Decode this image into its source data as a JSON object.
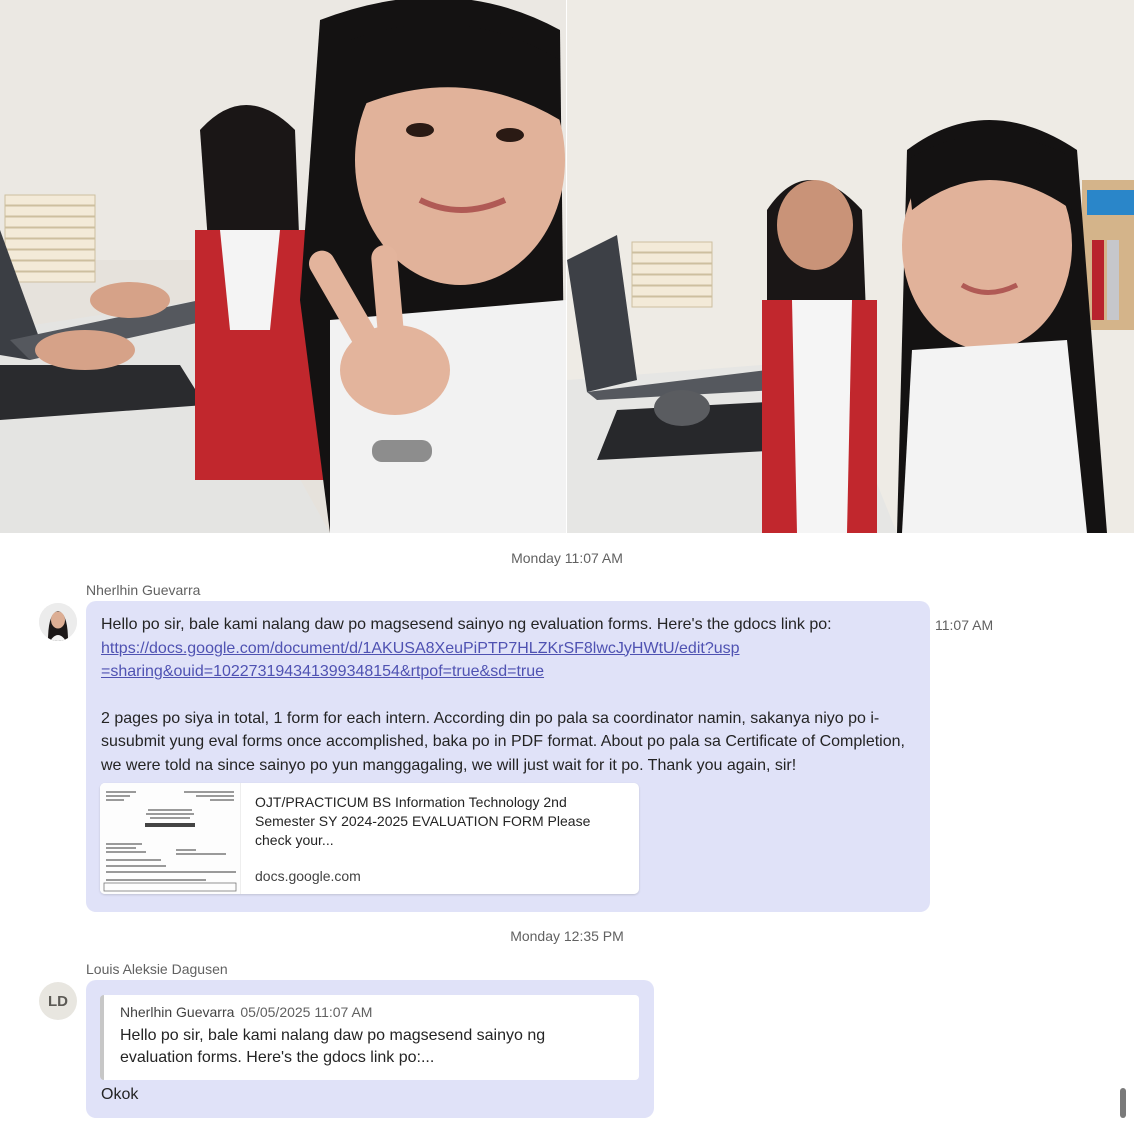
{
  "photos": [
    {
      "name": "photo-selfie-at-desk"
    },
    {
      "name": "photo-two-interns"
    }
  ],
  "divider_1": "Monday 11:07 AM",
  "message_1": {
    "sender": "Nherlhin Guevarra",
    "time": "11:07 AM",
    "text_intro": "Hello po sir, bale kami nalang daw po magsesend sainyo ng evaluation forms. Here's the gdocs link po:",
    "link": "https://docs.google.com/document/d/1AKUSA8XeuPiPTP7HLZKrSF8lwcJyHWtU/edit?usp=sharing&ouid=102273194341399348154&rtpof=true&sd=true",
    "text_body": "2 pages po siya in total, 1 form for each intern. According din po pala sa coordinator namin, sakanya niyo po i-susubmit yung eval forms once accomplished, baka po in PDF format. About po pala sa Certificate of Completion, we were told na since sainyo po yun manggagaling, we will just wait for it po. Thank you again, sir!",
    "preview": {
      "title": "OJT/PRACTICUM BS Information Technology 2nd Semester SY 2024-2025 EVALUATION FORM Please check your...",
      "domain": "docs.google.com",
      "thumb_heading": "EVALUATION FORM"
    }
  },
  "divider_2": "Monday 12:35 PM",
  "message_2": {
    "sender": "Louis Aleksie Dagusen",
    "avatar_initials": "LD",
    "quote": {
      "sender": "Nherlhin Guevarra",
      "time": "05/05/2025 11:07 AM",
      "text": "Hello po sir, bale kami nalang daw po magsesend sainyo ng evaluation forms. Here's the gdocs link po:..."
    },
    "text": "Okok"
  },
  "colors": {
    "bubble": "#e0e2f8",
    "link": "#4f52b2",
    "muted": "#616161"
  }
}
